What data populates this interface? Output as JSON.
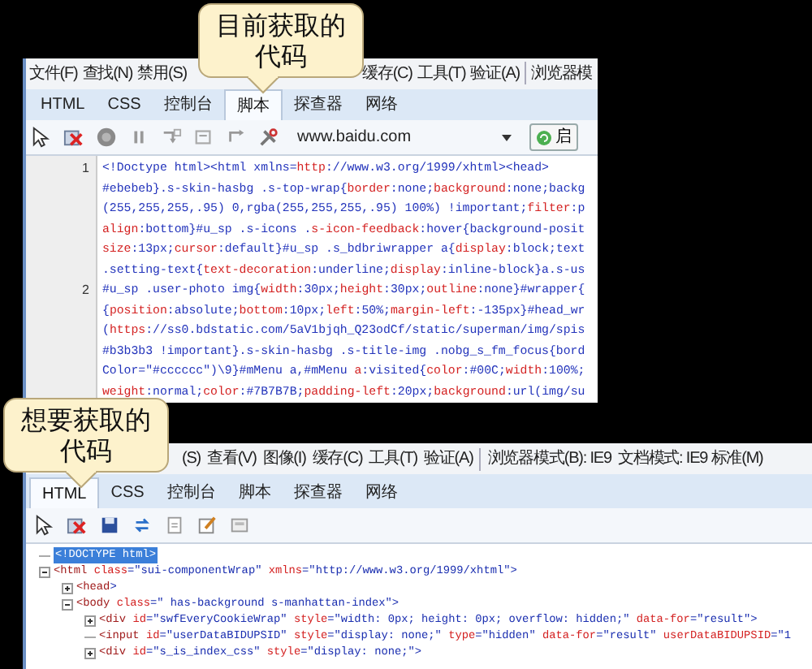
{
  "top_window": {
    "menu": [
      "文件(F)",
      "查找(N)",
      "禁用(S)",
      "缓存(C)",
      "工具(T)",
      "验证(A)",
      "浏览器模"
    ],
    "tabs": [
      {
        "label": "HTML",
        "selected": false
      },
      {
        "label": "CSS",
        "selected": false
      },
      {
        "label": "控制台",
        "selected": false
      },
      {
        "label": "脚本",
        "selected": true
      },
      {
        "label": "探查器",
        "selected": false
      },
      {
        "label": "网络",
        "selected": false
      }
    ],
    "address": "www.baidu.com",
    "button": "启",
    "code_lines": [
      {
        "number": "1",
        "text": "<!Doctype html><html xmlns=http://www.w3.org/1999/xhtml><head>"
      },
      {
        "text": "#ebebeb}.s-skin-hasbg .s-top-wrap{border:none;background:none;backg"
      },
      {
        "text": "(255,255,255,.95) 0,rgba(255,255,255,.95) 100%) !important;filter:p"
      },
      {
        "text": "align:bottom}#u_sp .s-icons .s-icon-feedback:hover{background-posit"
      },
      {
        "text": "size:13px;cursor:default}#u_sp .s_bdbriwrapper a{display:block;text"
      },
      {
        "text": ".setting-text{text-decoration:underline;display:inline-block}a.s-us"
      },
      {
        "number": "2",
        "text": "#u_sp .user-photo img{width:30px;height:30px;outline:none}#wrapper{"
      },
      {
        "text": "{position:absolute;bottom:10px;left:50%;margin-left:-135px}#head_wr"
      },
      {
        "text": "(https://ss0.bdstatic.com/5aV1bjqh_Q23odCf/static/superman/img/spis"
      },
      {
        "text": "#b3b3b3 !important}.s-skin-hasbg .s-title-img .nobg_s_fm_focus{bord"
      },
      {
        "text": "Color=\"#cccccc\")\\9}#mMenu a,#mMenu a:visited{color:#00C;width:100%;"
      },
      {
        "text": "weight:normal;color:#7B7B7B;padding-left:20px;background:url(img/su"
      }
    ]
  },
  "callouts": [
    {
      "text": "目前获取的代码"
    },
    {
      "text": "想要获取的代码"
    }
  ],
  "bottom_window": {
    "menu": [
      "(S)",
      "查看(V)",
      "图像(I)",
      "缓存(C)",
      "工具(T)",
      "验证(A)"
    ],
    "modes": [
      "浏览器模式(B): IE9",
      "文档模式: IE9 标准(M)"
    ],
    "tabs": [
      {
        "label": "HTML",
        "selected": true
      },
      {
        "label": "CSS",
        "selected": false
      },
      {
        "label": "控制台",
        "selected": false
      },
      {
        "label": "脚本",
        "selected": false
      },
      {
        "label": "探查器",
        "selected": false
      },
      {
        "label": "网络",
        "selected": false
      }
    ],
    "tree": [
      {
        "kind": "leaf",
        "text": "<!DOCTYPE html>",
        "selected": true
      },
      {
        "kind": "element",
        "text": "<html class=\"sui-componentWrap\" xmlns=\"http://www.w3.org/1999/xhtml\">",
        "selected": false,
        "expanded": true,
        "children": [
          {
            "kind": "element",
            "text": "<head>",
            "selected": false,
            "expanded": false
          },
          {
            "kind": "element",
            "text": "<body class=\" has-background s-manhattan-index\">",
            "selected": false,
            "expanded": true,
            "children": [
              {
                "kind": "element",
                "text": "<div id=\"swfEveryCookieWrap\" style=\"width: 0px; height: 0px; overflow: hidden;\" data-for=\"result\">",
                "selected": false,
                "expanded": false
              },
              {
                "kind": "leaf",
                "text": "<input id=\"userDataBIDUPSID\" style=\"display: none;\" type=\"hidden\" data-for=\"result\" userDataBIDUPSID=\"1",
                "selected": false
              },
              {
                "kind": "element",
                "text": "<div id=\"s_is_index_css\" style=\"display: none;\">",
                "selected": false,
                "expanded": false
              }
            ]
          }
        ]
      }
    ]
  }
}
